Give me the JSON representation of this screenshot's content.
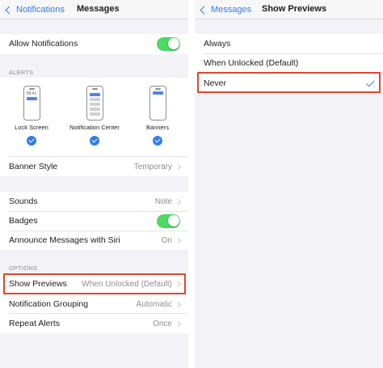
{
  "left_panel": {
    "back_label": "Notifications",
    "title": "Messages",
    "allow_notifications": {
      "label": "Allow Notifications",
      "enabled": true
    },
    "alerts_header": "ALERTS",
    "alert_styles": [
      {
        "label": "Lock Screen",
        "screen_time": "09:41",
        "selected": true
      },
      {
        "label": "Notification Center",
        "selected": true
      },
      {
        "label": "Banners",
        "selected": true
      }
    ],
    "banner_style": {
      "label": "Banner Style",
      "value": "Temporary"
    },
    "sounds": {
      "label": "Sounds",
      "value": "Note"
    },
    "badges": {
      "label": "Badges",
      "enabled": true
    },
    "announce": {
      "label": "Announce Messages with Siri",
      "value": "On"
    },
    "options_header": "OPTIONS",
    "show_previews": {
      "label": "Show Previews",
      "value": "When Unlocked (Default)"
    },
    "grouping": {
      "label": "Notification Grouping",
      "value": "Automatic"
    },
    "repeat": {
      "label": "Repeat Alerts",
      "value": "Once"
    }
  },
  "right_panel": {
    "back_label": "Messages",
    "title": "Show Previews",
    "options": [
      {
        "label": "Always",
        "selected": false
      },
      {
        "label": "When Unlocked (Default)",
        "selected": false
      },
      {
        "label": "Never",
        "selected": true
      }
    ]
  },
  "colors": {
    "accent": "#2f7cf6",
    "toggle_on": "#4cd964",
    "highlight": "#e0452c",
    "group_bg": "#f2f2f7"
  }
}
